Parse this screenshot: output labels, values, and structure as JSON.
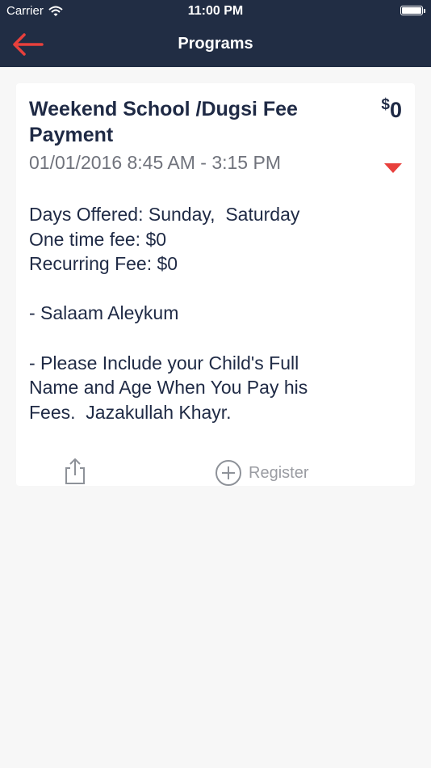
{
  "status_bar": {
    "carrier": "Carrier",
    "time": "11:00 PM",
    "battery_level": 1.0
  },
  "nav": {
    "title": "Programs",
    "back_icon": "back-arrow-icon"
  },
  "colors": {
    "header_bg": "#212d44",
    "accent": "#e8403c",
    "title_text": "#1f2a45",
    "muted_text": "#70737c",
    "background": "#f7f7f7"
  },
  "program": {
    "title": "Weekend  School /Dugsi Fee Payment",
    "price_currency": "$",
    "price_amount": "0",
    "date_range": "01/01/2016 8:45 AM - 3:15 PM",
    "description_lines": [
      "Days Offered: Sunday,  Saturday",
      "One time fee: $0",
      "Recurring Fee: $0",
      "",
      "- Salaam Aleykum",
      "",
      "- Please Include your Child's Full",
      "Name and Age When You Pay his",
      "Fees.  Jazakullah Khayr."
    ],
    "actions": {
      "share_icon": "share-icon",
      "register_label": "Register",
      "register_icon": "plus-circle-icon"
    }
  }
}
